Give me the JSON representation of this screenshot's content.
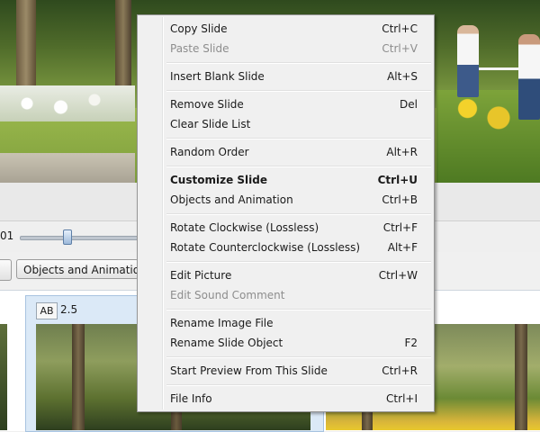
{
  "background": {
    "slider_value": "01",
    "objects_button_label": "Objects and Animation",
    "slide_badge": "AB",
    "slide_duration": "2.5"
  },
  "context_menu": {
    "items": [
      {
        "label": "Copy Slide",
        "shortcut": "Ctrl+C",
        "enabled": true,
        "bold": false
      },
      {
        "label": "Paste Slide",
        "shortcut": "Ctrl+V",
        "enabled": false,
        "bold": false
      },
      {
        "label": "Insert Blank Slide",
        "shortcut": "Alt+S",
        "enabled": true,
        "bold": false
      },
      {
        "label": "Remove Slide",
        "shortcut": "Del",
        "enabled": true,
        "bold": false
      },
      {
        "label": "Clear Slide List",
        "shortcut": "",
        "enabled": true,
        "bold": false
      },
      {
        "label": "Random Order",
        "shortcut": "Alt+R",
        "enabled": true,
        "bold": false
      },
      {
        "label": "Customize Slide",
        "shortcut": "Ctrl+U",
        "enabled": true,
        "bold": true
      },
      {
        "label": "Objects and Animation",
        "shortcut": "Ctrl+B",
        "enabled": true,
        "bold": false
      },
      {
        "label": "Rotate Clockwise (Lossless)",
        "shortcut": "Ctrl+F",
        "enabled": true,
        "bold": false
      },
      {
        "label": "Rotate Counterclockwise (Lossless)",
        "shortcut": "Alt+F",
        "enabled": true,
        "bold": false
      },
      {
        "label": "Edit Picture",
        "shortcut": "Ctrl+W",
        "enabled": true,
        "bold": false
      },
      {
        "label": "Edit Sound Comment",
        "shortcut": "",
        "enabled": false,
        "bold": false
      },
      {
        "label": "Rename Image File",
        "shortcut": "",
        "enabled": true,
        "bold": false
      },
      {
        "label": "Rename Slide Object",
        "shortcut": "F2",
        "enabled": true,
        "bold": false
      },
      {
        "label": "Start Preview From This Slide",
        "shortcut": "Ctrl+R",
        "enabled": true,
        "bold": false
      },
      {
        "label": "File Info",
        "shortcut": "Ctrl+I",
        "enabled": true,
        "bold": false
      }
    ]
  }
}
